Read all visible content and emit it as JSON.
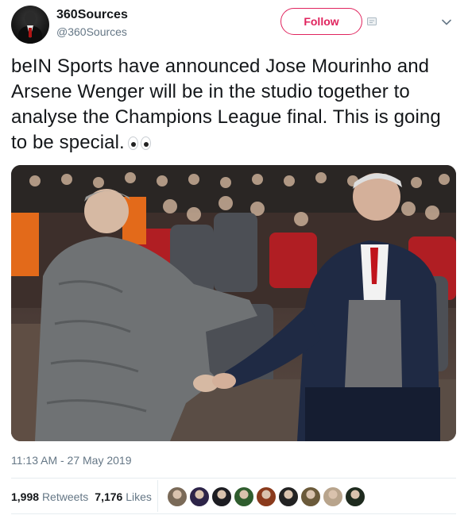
{
  "account": {
    "name": "360Sources",
    "handle": "@360Sources",
    "avatar_icon": "avatar-suit-and-tie"
  },
  "header": {
    "follow_label": "Follow",
    "follow_color": "#e0245e",
    "more_icon": "chevron-down-icon"
  },
  "tweet": {
    "text": "beIN Sports have announced Jose Mourinho and Arsene Wenger will be in the studio together to analyse the Champions League final. This is going to be special.",
    "emoji": "eyes",
    "image": "photo-two-managers-shaking-hands-in-stadium"
  },
  "meta": {
    "timestamp": "11:13 AM - 27 May 2019"
  },
  "stats": {
    "retweets_count": "1,998",
    "retweets_label": "Retweets",
    "likes_count": "7,176",
    "likes_label": "Likes"
  },
  "likers": [
    {
      "color": "#7a6a58"
    },
    {
      "color": "#2d2448"
    },
    {
      "color": "#1d1d22"
    },
    {
      "color": "#2f5d2e"
    },
    {
      "color": "#8a3a1c"
    },
    {
      "color": "#222222"
    },
    {
      "color": "#6b5a3a"
    },
    {
      "color": "#b8a48c"
    },
    {
      "color": "#1e2a1e"
    }
  ]
}
